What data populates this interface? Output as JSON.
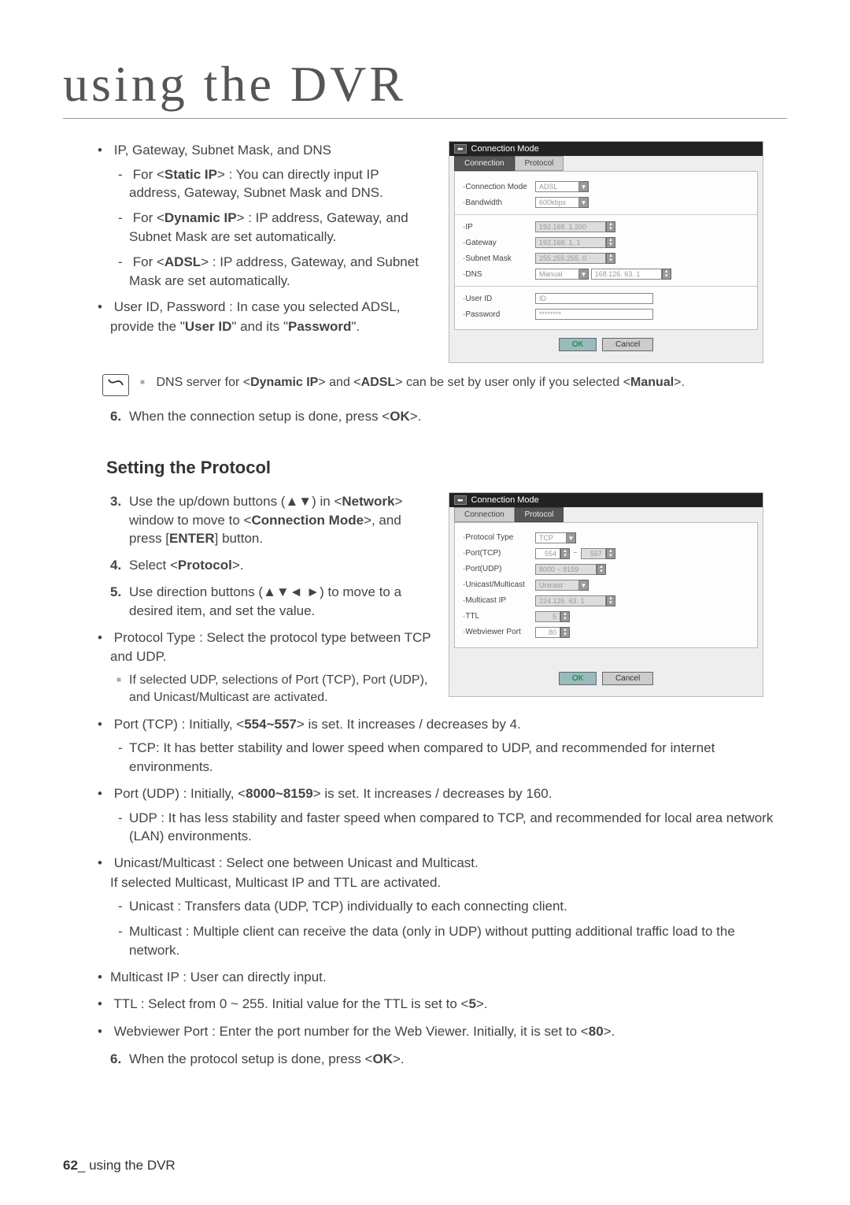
{
  "title": "using the DVR",
  "footer": {
    "page": "62",
    "suffix": "_ using the DVR"
  },
  "sec1": {
    "bullet1": "IP, Gateway, Subnet Mask, and DNS",
    "sub1a_pre": "For <",
    "sub1a_b": "Static IP",
    "sub1a_post": "> : You can directly input IP address, Gateway, Subnet Mask and DNS.",
    "sub1b_pre": "For <",
    "sub1b_b": "Dynamic IP",
    "sub1b_post": "> : IP address, Gateway, and Subnet Mask are set automatically.",
    "sub1c_pre": "For <",
    "sub1c_b": "ADSL",
    "sub1c_post": "> : IP address, Gateway, and Subnet Mask are set automatically.",
    "bullet2_pre": "User ID, Password : In case you selected ADSL, provide the \"",
    "bullet2_b1": "User ID",
    "bullet2_mid": "\" and its \"",
    "bullet2_b2": "Password",
    "bullet2_post": "\".",
    "note_pre": "DNS server for <",
    "note_b1": "Dynamic IP",
    "note_mid": "> and <",
    "note_b2": "ADSL",
    "note_mid2": "> can be set by user only if you selected <",
    "note_b3": "Manual",
    "note_post": ">.",
    "step6_num": "6.",
    "step6_pre": "When the connection setup is done, press <",
    "step6_b": "OK",
    "step6_post": ">."
  },
  "sec2": {
    "heading": "Setting the Protocol",
    "step3_num": "3.",
    "step3_pre": "Use the up/down buttons (▲▼) in <",
    "step3_b": "Network",
    "step3_mid": "> window to move to <",
    "step3_b2": "Connection Mode",
    "step3_mid2": ">, and press [",
    "step3_b3": "ENTER",
    "step3_post": "] button.",
    "step4_num": "4.",
    "step4_pre": "Select <",
    "step4_b": "Protocol",
    "step4_post": ">.",
    "step5_num": "5.",
    "step5_text": "Use direction buttons (▲▼◄ ►) to move to a desired item, and set the value.",
    "bul_pt": "Protocol Type : Select the protocol type between TCP and UDP.",
    "bul_pt_sub": "If selected UDP, selections of Port (TCP), Port (UDP), and Unicast/Multicast are activated.",
    "bul_ptcp_pre": "Port (TCP) : Initially, <",
    "bul_ptcp_b": "554~557",
    "bul_ptcp_post": "> is set. It increases / decreases by 4.",
    "bul_ptcp_sub": "TCP: It has better stability and lower speed when compared to UDP, and recommended for internet environments.",
    "bul_pudp_pre": "Port (UDP) : Initially, <",
    "bul_pudp_b": "8000~8159",
    "bul_pudp_post": "> is set. It increases / decreases by 160.",
    "bul_pudp_sub": "UDP : It has less stability and faster speed when compared to TCP, and recommended for local area network (LAN) environments.",
    "bul_um_l1": "Unicast/Multicast : Select one between Unicast and Multicast.",
    "bul_um_l2": "If selected Multicast, Multicast IP and TTL are activated.",
    "bul_um_sub1": "Unicast : Transfers data (UDP, TCP) individually to each connecting client.",
    "bul_um_sub2": "Multicast : Multiple client can receive the data (only in UDP) without putting additional traffic load to the network.",
    "bul_mip": "Multicast IP : User can directly input.",
    "bul_ttl_pre": "TTL : Select from 0 ~ 255. Initial value for the TTL is set to <",
    "bul_ttl_b": "5",
    "bul_ttl_post": ">.",
    "bul_wv_pre": "Webviewer Port : Enter the port number for the Web Viewer. Initially, it is set to <",
    "bul_wv_b": "80",
    "bul_wv_post": ">.",
    "step6_num": "6.",
    "step6_pre": "When the protocol setup is done, press <",
    "step6_b": "OK",
    "step6_post": ">."
  },
  "dlg1": {
    "title": "Connection Mode",
    "tab_active": "Connection",
    "tab_inactive": "Protocol",
    "l_mode": "Connection Mode",
    "v_mode": "ADSL",
    "l_bw": "Bandwidth",
    "v_bw": "600kbps",
    "l_ip": "IP",
    "v_ip": "192.168.  1.200",
    "l_gw": "Gateway",
    "v_gw": "192.168.  1.  1",
    "l_sm": "Subnet Mask",
    "v_sm": "255.255.255.  0",
    "l_dns": "DNS",
    "v_dns_mode": "Manual",
    "v_dns_ip": "168.126. 63.  1",
    "l_uid": "User ID",
    "v_uid": "ID",
    "l_pwd": "Password",
    "v_pwd": "********",
    "ok": "OK",
    "cancel": "Cancel"
  },
  "dlg2": {
    "title": "Connection Mode",
    "tab_inactive": "Connection",
    "tab_active": "Protocol",
    "l_pt": "Protocol Type",
    "v_pt": "TCP",
    "l_ptcp": "Port(TCP)",
    "v_ptcp1": "554",
    "v_ptcp2": "557",
    "l_pudp": "Port(UDP)",
    "v_pudp": "8000 ~ 8159",
    "l_um": "Unicast/Multicast",
    "v_um": "Unicast",
    "l_mip": "Multicast IP",
    "v_mip": "224.126. 63.  1",
    "l_ttl": "TTL",
    "v_ttl": "5",
    "l_wv": "Webviewer Port",
    "v_wv": "80",
    "ok": "OK",
    "cancel": "Cancel"
  }
}
